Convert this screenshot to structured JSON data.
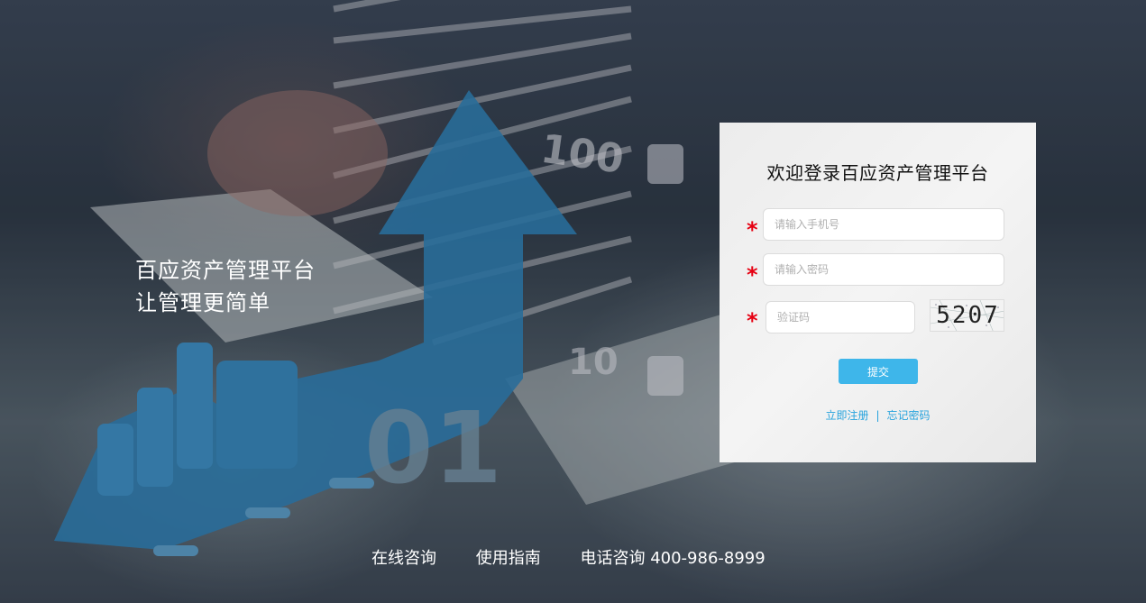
{
  "slogan": {
    "line1": "百应资产管理平台",
    "line2": "让管理更简单"
  },
  "login": {
    "title": "欢迎登录百应资产管理平台",
    "required_mark": "*",
    "phone_placeholder": "请输入手机号",
    "password_placeholder": "请输入密码",
    "captcha_placeholder": "验证码",
    "captcha_text": "5207",
    "submit_label": "提交",
    "register_link": "立即注册",
    "separator": "|",
    "forgot_link": "忘记密码"
  },
  "footer": {
    "online": "在线咨询",
    "guide": "使用指南",
    "phone": "电话咨询 400-986-8999"
  },
  "background_art": {
    "label_100": "100",
    "label_10": "10"
  },
  "colors": {
    "accent": "#3eb6ea",
    "link": "#27a3dd",
    "required": "#e60012",
    "arrow": "#2e7eb3"
  }
}
